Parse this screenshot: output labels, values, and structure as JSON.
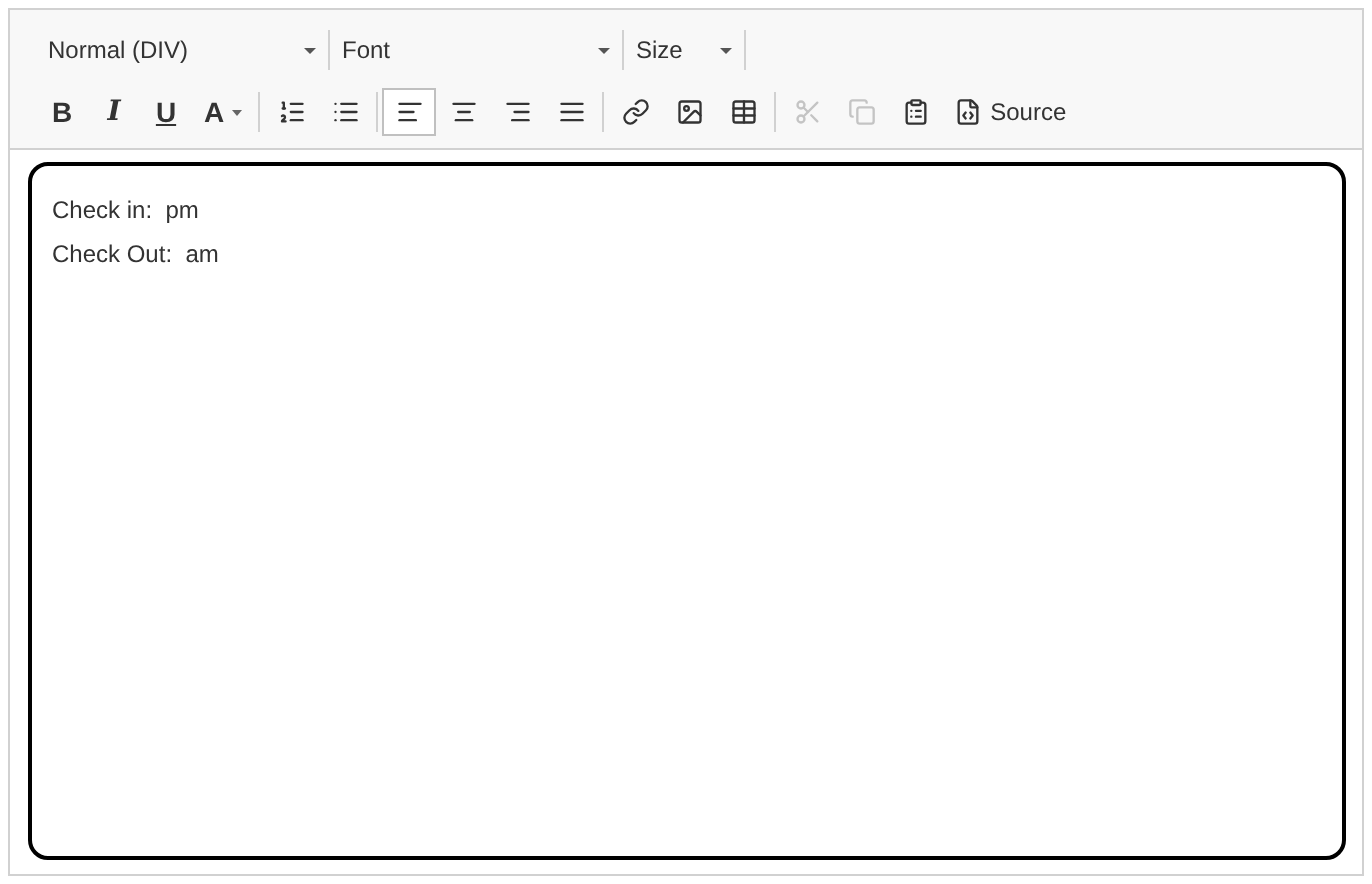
{
  "dropdowns": [
    {
      "label": "Normal (DIV)",
      "kind": "wide"
    },
    {
      "label": "Font",
      "kind": "wide"
    },
    {
      "label": "Size",
      "kind": "narrow"
    }
  ],
  "toolbar_groups": [
    [
      {
        "kind": "bold",
        "label": "B",
        "selected": false,
        "disabled": false
      },
      {
        "kind": "italic",
        "label": "I",
        "selected": false,
        "disabled": false
      },
      {
        "kind": "underline",
        "label": "U",
        "selected": false,
        "disabled": false
      },
      {
        "kind": "text-color",
        "label": "A",
        "selected": false,
        "disabled": false
      }
    ],
    [
      {
        "kind": "ordered-list",
        "selected": false,
        "disabled": false
      },
      {
        "kind": "bulleted-list",
        "selected": false,
        "disabled": false
      }
    ],
    [
      {
        "kind": "align-left",
        "selected": true,
        "disabled": false
      },
      {
        "kind": "align-center",
        "selected": false,
        "disabled": false
      },
      {
        "kind": "align-right",
        "selected": false,
        "disabled": false
      },
      {
        "kind": "justify",
        "selected": false,
        "disabled": false
      }
    ],
    [
      {
        "kind": "link",
        "selected": false,
        "disabled": false
      },
      {
        "kind": "image",
        "selected": false,
        "disabled": false
      },
      {
        "kind": "table",
        "selected": false,
        "disabled": false
      }
    ],
    [
      {
        "kind": "cut",
        "selected": false,
        "disabled": true
      },
      {
        "kind": "copy",
        "selected": false,
        "disabled": true
      },
      {
        "kind": "paste",
        "selected": false,
        "disabled": false
      },
      {
        "kind": "source",
        "label": "Source",
        "selected": false,
        "disabled": false
      }
    ]
  ],
  "content": [
    "Check in:  pm",
    "Check Out:  am"
  ]
}
